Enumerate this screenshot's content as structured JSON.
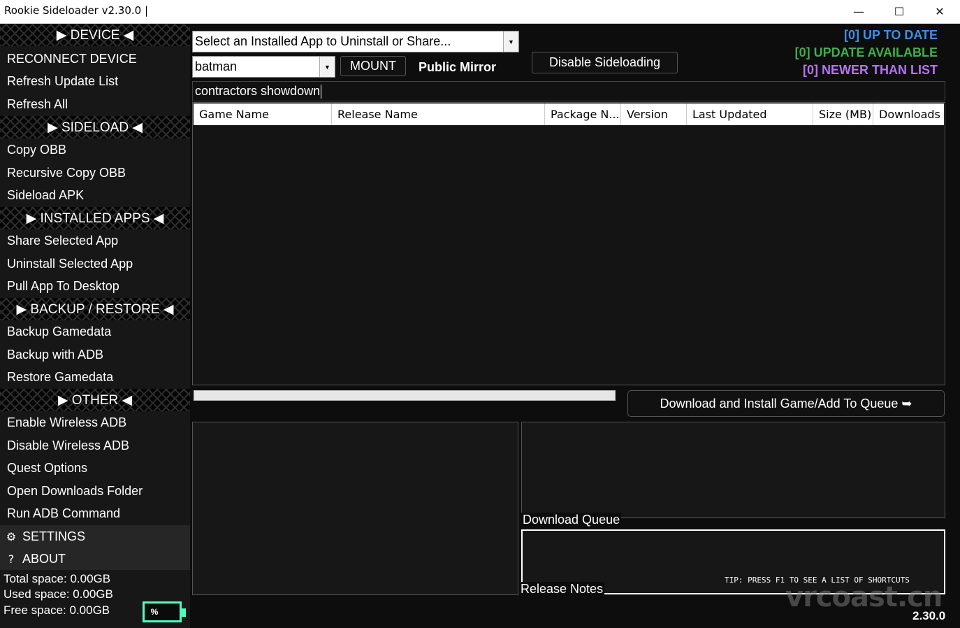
{
  "window": {
    "title": "Rookie Sideloader v2.30.0 |",
    "controls": {
      "minimize": "—",
      "maximize": "☐",
      "close": "✕"
    }
  },
  "sidebar": {
    "device": {
      "header": "▶ DEVICE ◀",
      "items": [
        "RECONNECT DEVICE",
        "Refresh Update List",
        "Refresh All"
      ]
    },
    "sideload": {
      "header": "▶ SIDELOAD ◀",
      "items": [
        "Copy OBB",
        "Recursive Copy OBB",
        "Sideload APK"
      ]
    },
    "installed": {
      "header": "▶ INSTALLED APPS ◀",
      "items": [
        "Share Selected App",
        "Uninstall Selected App",
        "Pull App To Desktop"
      ]
    },
    "backup": {
      "header": "▶ BACKUP / RESTORE ◀",
      "items": [
        "Backup Gamedata",
        "Backup with ADB",
        "Restore Gamedata"
      ]
    },
    "other": {
      "header": "▶ OTHER ◀",
      "items": [
        "Enable Wireless ADB",
        "Disable Wireless ADB",
        "Quest Options",
        "Open Downloads Folder",
        "Run ADB Command"
      ]
    },
    "settings": {
      "icon": "⚙",
      "label": "SETTINGS"
    },
    "about": {
      "icon": "?",
      "label": "ABOUT"
    },
    "space": {
      "total": "Total space: 0.00GB",
      "used": "Used space: 0.00GB",
      "free": "Free space: 0.00GB"
    },
    "battery": {
      "label": "%",
      "color": "#4dffbe"
    }
  },
  "toolbar": {
    "installed_select": "Select an Installed App to Uninstall or Share...",
    "mirror_select": "batman",
    "mount_label": "MOUNT",
    "mirror_label": "Public Mirror",
    "disable_sideloading": "Disable Sideloading"
  },
  "status": {
    "up_to_date": {
      "text": "[0] UP TO DATE",
      "color": "#3d8ee8"
    },
    "update_available": {
      "text": "[0] UPDATE AVAILABLE",
      "color": "#3fae4a"
    },
    "newer_than_list": {
      "text": "[0] NEWER THAN LIST",
      "color": "#b474f2"
    }
  },
  "search": {
    "value": "contractors showdown"
  },
  "table": {
    "columns": [
      "Game Name",
      "Release Name",
      "Package N...",
      "Version",
      "Last Updated",
      "Size (MB)",
      "Downloads"
    ],
    "rows": []
  },
  "progress": {
    "percent": 0
  },
  "download_button": "Download and Install Game/Add To Queue ➥",
  "panels": {
    "download_queue_label": "Download Queue",
    "release_notes_label": "Release Notes",
    "tip": "TIP: PRESS F1 TO SEE A LIST OF SHORTCUTS"
  },
  "watermark": "vrcoast.cn",
  "version": "2.30.0"
}
